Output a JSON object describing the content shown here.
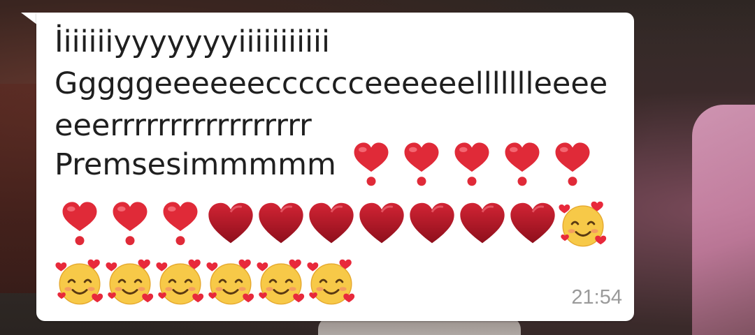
{
  "message": {
    "line1": "İiiiiiiyyyyyyyiiiiiiiiiii",
    "line2": "Gggggeeeeeecccccceeeeeellllllleeee",
    "line3": "eeerrrrrrrrrrrrrrrrr",
    "line4_text": "Premsesimmmmm",
    "time": "21:54"
  },
  "emojis": {
    "row1": [
      "heart-exclamation-icon",
      "heart-exclamation-icon",
      "heart-exclamation-icon",
      "heart-exclamation-icon",
      "heart-exclamation-icon"
    ],
    "row2": [
      "heart-exclamation-icon",
      "heart-exclamation-icon",
      "heart-exclamation-icon",
      "red-heart-icon",
      "red-heart-icon",
      "red-heart-icon",
      "red-heart-icon",
      "red-heart-icon",
      "red-heart-icon",
      "red-heart-icon",
      "smiling-face-with-hearts-icon"
    ],
    "row3": [
      "smiling-face-with-hearts-icon",
      "smiling-face-with-hearts-icon",
      "smiling-face-with-hearts-icon",
      "smiling-face-with-hearts-icon",
      "smiling-face-with-hearts-icon",
      "smiling-face-with-hearts-icon"
    ]
  },
  "colors": {
    "bubble": "#ffffff",
    "text": "#1f1f1f",
    "time": "#9a9a9a",
    "heart": "#e02a38",
    "heart_dark": "#b81a28",
    "face": "#f7c948"
  }
}
